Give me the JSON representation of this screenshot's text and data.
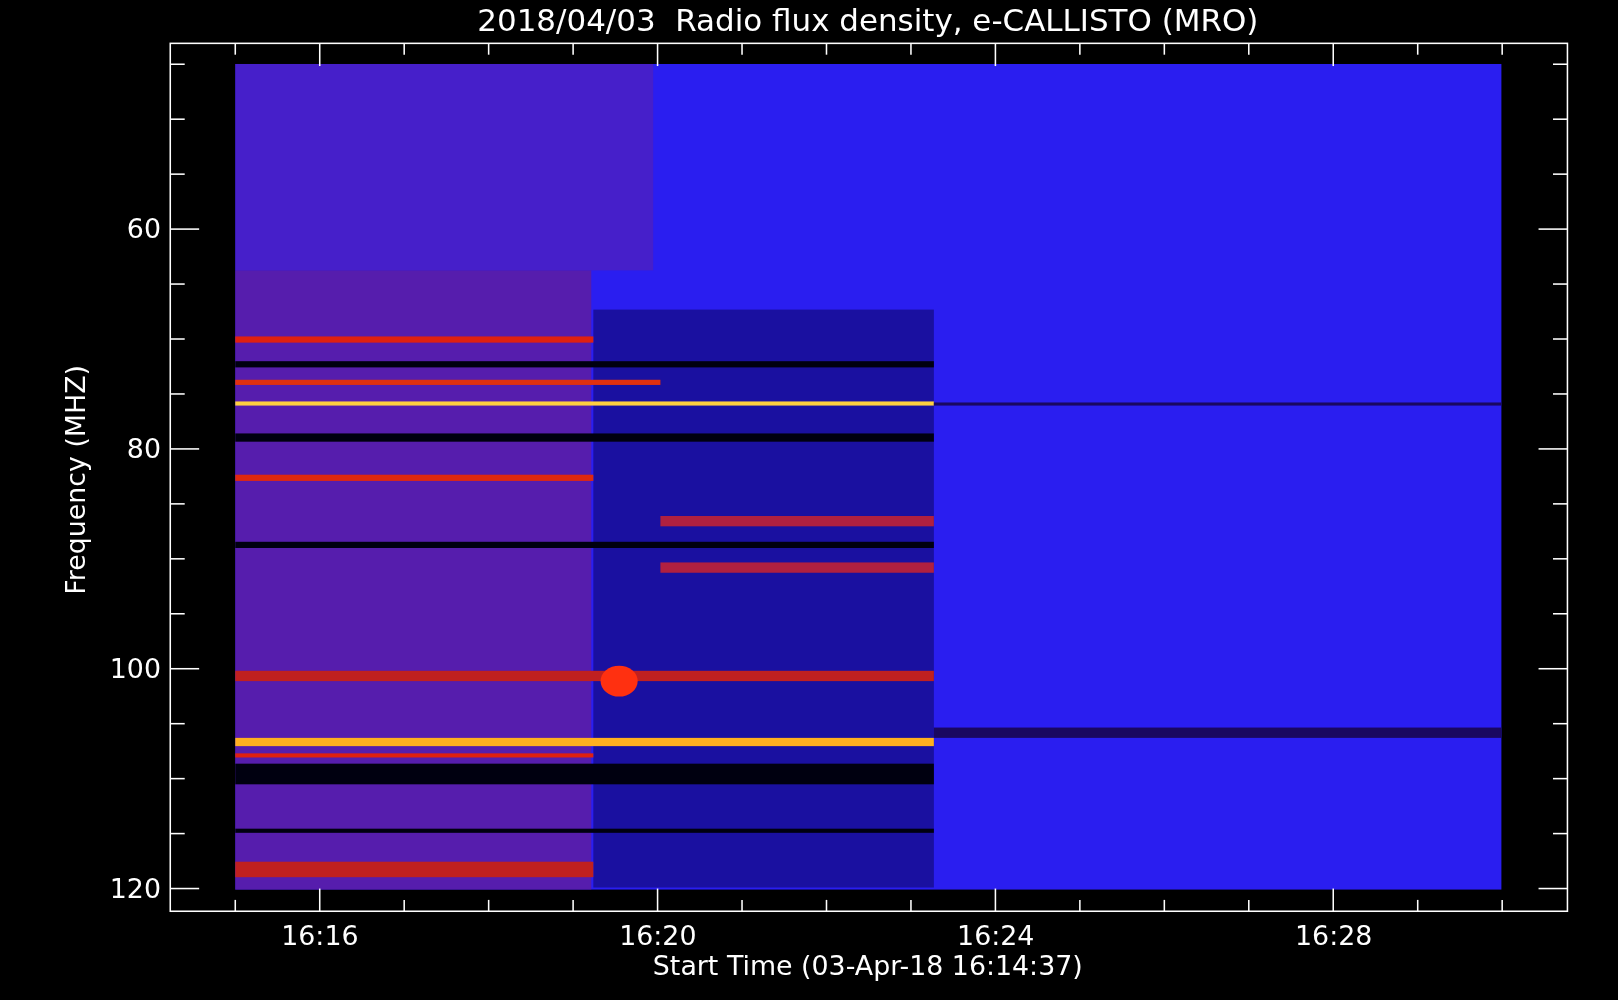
{
  "title": "2018/04/03  Radio flux density, e-CALLISTO (MRO)",
  "plot": {
    "ylabel": "Frequency (MHZ)",
    "xlabel": "Start Time (03-Apr-18 16:14:37)",
    "yticks": [
      "60",
      "80",
      "100",
      "120"
    ],
    "xticks": [
      "16:16",
      "16:20",
      "16:24",
      "16:28"
    ]
  }
}
